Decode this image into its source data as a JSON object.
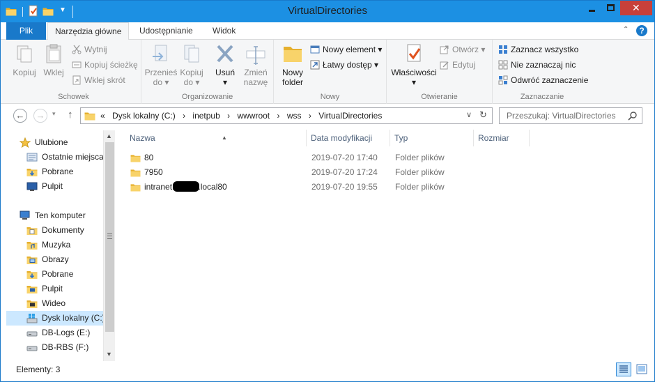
{
  "window": {
    "title": "VirtualDirectories",
    "buttons": {
      "minimize": "minimize",
      "maximize": "maximize",
      "close": "close"
    }
  },
  "ribbon_tabs": {
    "file": "Plik",
    "home": "Narzędzia główne",
    "share": "Udostępnianie",
    "view": "Widok",
    "help": "?"
  },
  "ribbon": {
    "clipboard": {
      "label": "Schowek",
      "copy": "Kopiuj",
      "paste": "Wklej",
      "cut": "Wytnij",
      "copy_path": "Kopiuj ścieżkę",
      "paste_shortcut": "Wklej skrót"
    },
    "organize": {
      "label": "Organizowanie",
      "move_to": [
        "Przenieś",
        "do ▾"
      ],
      "copy_to": [
        "Kopiuj",
        "do ▾"
      ],
      "delete": [
        "Usuń",
        "▾"
      ],
      "rename": [
        "Zmień",
        "nazwę"
      ]
    },
    "new": {
      "label": "Nowy",
      "new_folder": [
        "Nowy",
        "folder"
      ],
      "new_item": "Nowy element ▾",
      "easy_access": "Łatwy dostęp ▾"
    },
    "open": {
      "label": "Otwieranie",
      "properties": [
        "Właściwości",
        "▾"
      ],
      "open": "Otwórz ▾",
      "edit": "Edytuj"
    },
    "select": {
      "label": "Zaznaczanie",
      "select_all": "Zaznacz wszystko",
      "select_none": "Nie zaznaczaj nic",
      "invert": "Odwróć zaznaczenie"
    }
  },
  "address": {
    "overflow": "«",
    "path": [
      "Dysk lokalny (C:)",
      "inetpub",
      "wwwroot",
      "wss",
      "VirtualDirectories"
    ],
    "separator": "›"
  },
  "search": {
    "placeholder": "Przeszukaj: VirtualDirectories"
  },
  "nav_tree": {
    "favorites": "Ulubione",
    "recent": "Ostatnie miejsca",
    "downloads_fav": "Pobrane",
    "desktop_fav": "Pulpit",
    "computer": "Ten komputer",
    "documents": "Dokumenty",
    "music": "Muzyka",
    "pictures": "Obrazy",
    "downloads": "Pobrane",
    "desktop": "Pulpit",
    "videos": "Wideo",
    "drive_c": "Dysk lokalny (C:)",
    "drive_e": "DB-Logs (E:)",
    "drive_f": "DB-RBS (F:)"
  },
  "columns": {
    "name": "Nazwa",
    "date": "Data modyfikacji",
    "type": "Typ",
    "size": "Rozmiar"
  },
  "files": [
    {
      "name": "80",
      "date": "2019-07-20 17:40",
      "type": "Folder plików"
    },
    {
      "name": "7950",
      "date": "2019-07-20 17:24",
      "type": "Folder plików"
    },
    {
      "name_prefix": "intranet.",
      "name_suffix": ".local80",
      "date": "2019-07-20 19:55",
      "type": "Folder plików"
    }
  ],
  "status": {
    "items": "Elementy: 3"
  },
  "colors": {
    "titlebar": "#1c90e3",
    "file_tab": "#1979ca",
    "close": "#c7403a",
    "folder": "#f5c242",
    "selection": "#cce8ff"
  }
}
